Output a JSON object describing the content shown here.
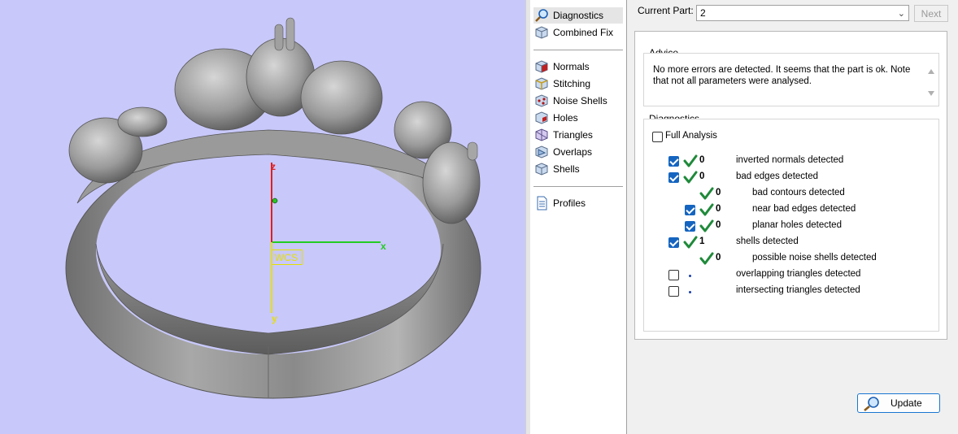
{
  "viewport": {
    "background": "#c8c8fa",
    "wcs_label": "WCS",
    "axis_x": "x",
    "axis_y": "y",
    "axis_z": "z"
  },
  "nav": {
    "items": [
      {
        "label": "Diagnostics",
        "icon": "magnifier-icon",
        "selected": true
      },
      {
        "label": "Combined Fix",
        "icon": "cube-icon"
      },
      {
        "label": "Normals",
        "icon": "normals-cube-icon"
      },
      {
        "label": "Stitching",
        "icon": "stitching-cube-icon"
      },
      {
        "label": "Noise Shells",
        "icon": "noise-shells-icon"
      },
      {
        "label": "Holes",
        "icon": "holes-cube-icon"
      },
      {
        "label": "Triangles",
        "icon": "triangles-icon"
      },
      {
        "label": "Overlaps",
        "icon": "overlaps-icon"
      },
      {
        "label": "Shells",
        "icon": "shells-icon"
      },
      {
        "label": "Profiles",
        "icon": "document-icon"
      }
    ]
  },
  "panel": {
    "current_part_label": "Current Part:",
    "current_part_value": "2",
    "next_label": "Next",
    "advice_title": "Advice",
    "advice_text": "No more errors are detected. It seems that the part is ok. Note that not all parameters were analysed.",
    "diagnostics_title": "Diagnostics",
    "full_analysis_label": "Full Analysis",
    "full_analysis_checked": false,
    "update_label": "Update",
    "rows": [
      {
        "checkbox": true,
        "checked": true,
        "status": "ok",
        "count": "0",
        "label": "inverted normals detected",
        "indent": 0
      },
      {
        "checkbox": true,
        "checked": true,
        "status": "ok",
        "count": "0",
        "label": "bad edges detected",
        "indent": 0
      },
      {
        "checkbox": false,
        "checked": false,
        "status": "ok",
        "count": "0",
        "label": "bad contours detected",
        "indent": 1
      },
      {
        "checkbox": true,
        "checked": true,
        "status": "ok",
        "count": "0",
        "label": "near bad edges detected",
        "indent": 1
      },
      {
        "checkbox": true,
        "checked": true,
        "status": "ok",
        "count": "0",
        "label": "planar holes detected",
        "indent": 1
      },
      {
        "checkbox": true,
        "checked": true,
        "status": "ok",
        "count": "1",
        "label": "shells detected",
        "indent": 0
      },
      {
        "checkbox": false,
        "checked": false,
        "status": "ok",
        "count": "0",
        "label": "possible noise shells detected",
        "indent": 1
      },
      {
        "checkbox": true,
        "checked": false,
        "status": "pending",
        "count": "",
        "label": "overlapping triangles detected",
        "indent": 0
      },
      {
        "checkbox": true,
        "checked": false,
        "status": "pending",
        "count": "",
        "label": "intersecting triangles detected",
        "indent": 0
      }
    ]
  }
}
